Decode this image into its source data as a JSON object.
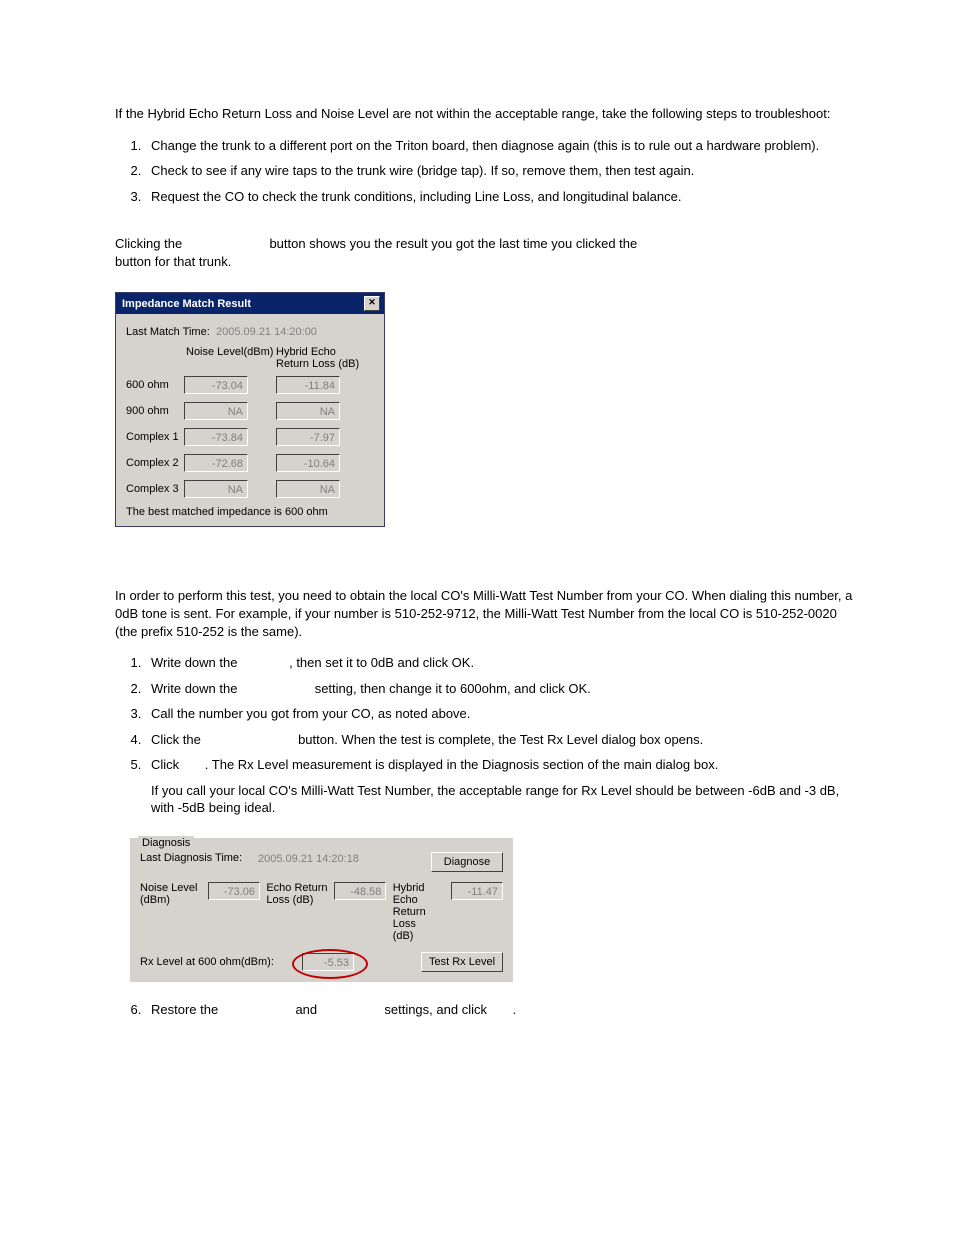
{
  "intro": "If the Hybrid Echo Return Loss and Noise Level are not within the acceptable range, take the following steps to troubleshoot:",
  "ts": [
    "Change the trunk to a different port on the Triton board, then diagnose again (this is to rule out a hardware problem).",
    "Check to see if any wire taps to the trunk wire (bridge tap). If so, remove them, then test again.",
    "Request the CO to check the trunk conditions, including Line Loss, and longitudinal balance."
  ],
  "click1a": "Clicking the ",
  "click1b": " button shows you the result you got the last time you clicked the ",
  "click1c": "button for that trunk.",
  "dlg": {
    "title": "Impedance Match Result",
    "lmt_label": "Last Match Time:",
    "lmt_val": "2005.09.21 14:20:00",
    "col_noise": "Noise Level(dBm)",
    "col_herl1": "Hybrid Echo",
    "col_herl2": "Return Loss (dB)",
    "rows": [
      {
        "lab": "600 ohm",
        "n": "-73.04",
        "h": "-11.84"
      },
      {
        "lab": "900 ohm",
        "n": "NA",
        "h": "NA"
      },
      {
        "lab": "Complex 1",
        "n": "-73.84",
        "h": "-7.97"
      },
      {
        "lab": "Complex 2",
        "n": "-72.68",
        "h": "-10.64"
      },
      {
        "lab": "Complex 3",
        "n": "NA",
        "h": "NA"
      }
    ],
    "foot": "The best matched impedance is 600 ohm"
  },
  "mw_intro": "In order to perform this test, you need to obtain the local CO's Milli-Watt Test Number from your CO. When dialing this number, a 0dB tone is sent. For example, if your number is 510-252-9712, the Milli-Watt Test Number from the local CO is 510-252-0020 (the prefix 510-252 is the same).",
  "mw": {
    "s1a": "Write down the ",
    "s1b": ", then set it to 0dB and click OK.",
    "s2a": "Write down the ",
    "s2b": " setting, then change it to 600ohm, and click OK.",
    "s3": "Call the number you got from your CO, as noted above.",
    "s4a": "Click the ",
    "s4b": " button. When the test is complete, the Test Rx Level dialog box opens.",
    "s5a": "Click ",
    "s5b": ". The Rx Level measurement is displayed in the Diagnosis section of the main dialog box.",
    "s5c": "If you call your local CO's Milli-Watt Test Number, the acceptable range for Rx Level should be between -6dB and -3 dB, with -5dB being ideal.",
    "s6a": "Restore the ",
    "s6b": " and ",
    "s6c": " settings, and click ",
    "s6d": "."
  },
  "diag": {
    "legend": "Diagnosis",
    "ldt_label": "Last Diagnosis Time:",
    "ldt_val": "2005.09.21 14:20:18",
    "btn_diag": "Diagnose",
    "noise_label1": "Noise Level",
    "noise_label2": "(dBm)",
    "noise_val": "-73.06",
    "erl_label1": "Echo Return",
    "erl_label2": "Loss (dB)",
    "erl_val": "-48.58",
    "herl_label1": "Hybrid Echo",
    "herl_label2": "Return Loss",
    "herl_label3": "(dB)",
    "herl_val": "-11.47",
    "rx_label": "Rx Level at 600 ohm(dBm):",
    "rx_val": "-5.53",
    "btn_rx": "Test Rx Level"
  }
}
